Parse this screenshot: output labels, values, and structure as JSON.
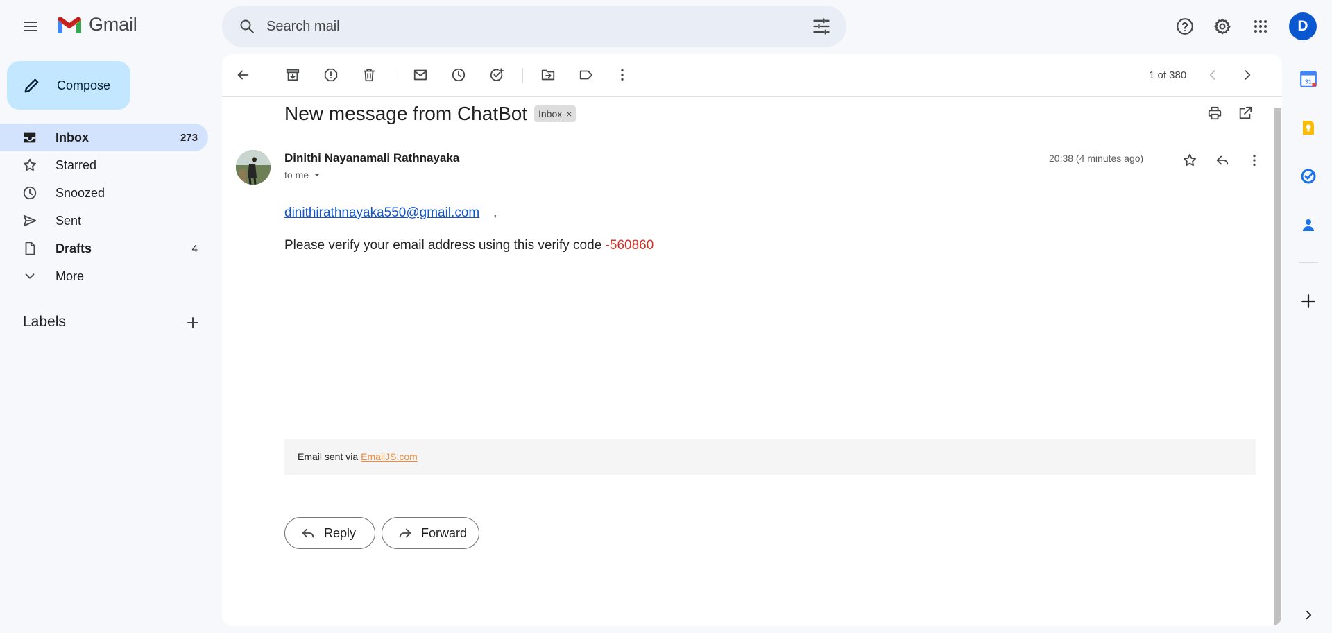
{
  "app": {
    "name": "Gmail",
    "account_initial": "D"
  },
  "search": {
    "placeholder": "Search mail"
  },
  "compose": {
    "label": "Compose"
  },
  "nav": [
    {
      "id": "inbox",
      "label": "Inbox",
      "count": "273",
      "icon": "inbox-icon",
      "active": true
    },
    {
      "id": "starred",
      "label": "Starred",
      "count": "",
      "icon": "star-icon"
    },
    {
      "id": "snoozed",
      "label": "Snoozed",
      "count": "",
      "icon": "clock-icon"
    },
    {
      "id": "sent",
      "label": "Sent",
      "count": "",
      "icon": "send-icon"
    },
    {
      "id": "drafts",
      "label": "Drafts",
      "count": "4",
      "icon": "draft-icon"
    },
    {
      "id": "more",
      "label": "More",
      "count": "",
      "icon": "chevron-down-icon"
    }
  ],
  "labels": {
    "header": "Labels"
  },
  "pager": {
    "text": "1 of 380"
  },
  "email": {
    "subject": "New message from ChatBot",
    "label_chip": "Inbox",
    "sender": "Dinithi Nayanamali Rathnayaka",
    "to": "to me",
    "timestamp": "20:38 (4 minutes ago)",
    "body_email_link": "dinithirathnayaka550@gmail.com",
    "body_comma": ",",
    "body_text": "Please verify your email address using this verify code ",
    "body_code": "-560860",
    "footer_prefix": "Email sent via",
    "footer_link": "EmailJS.com"
  },
  "actions": {
    "reply": "Reply",
    "forward": "Forward"
  },
  "colors": {
    "accent": "#0b57d0",
    "compose_bg": "#c2e7ff",
    "active_nav_bg": "#d3e3fd",
    "code_red": "#d93025",
    "link_blue": "#1155cc",
    "footer_link_orange": "#f28b3c"
  }
}
